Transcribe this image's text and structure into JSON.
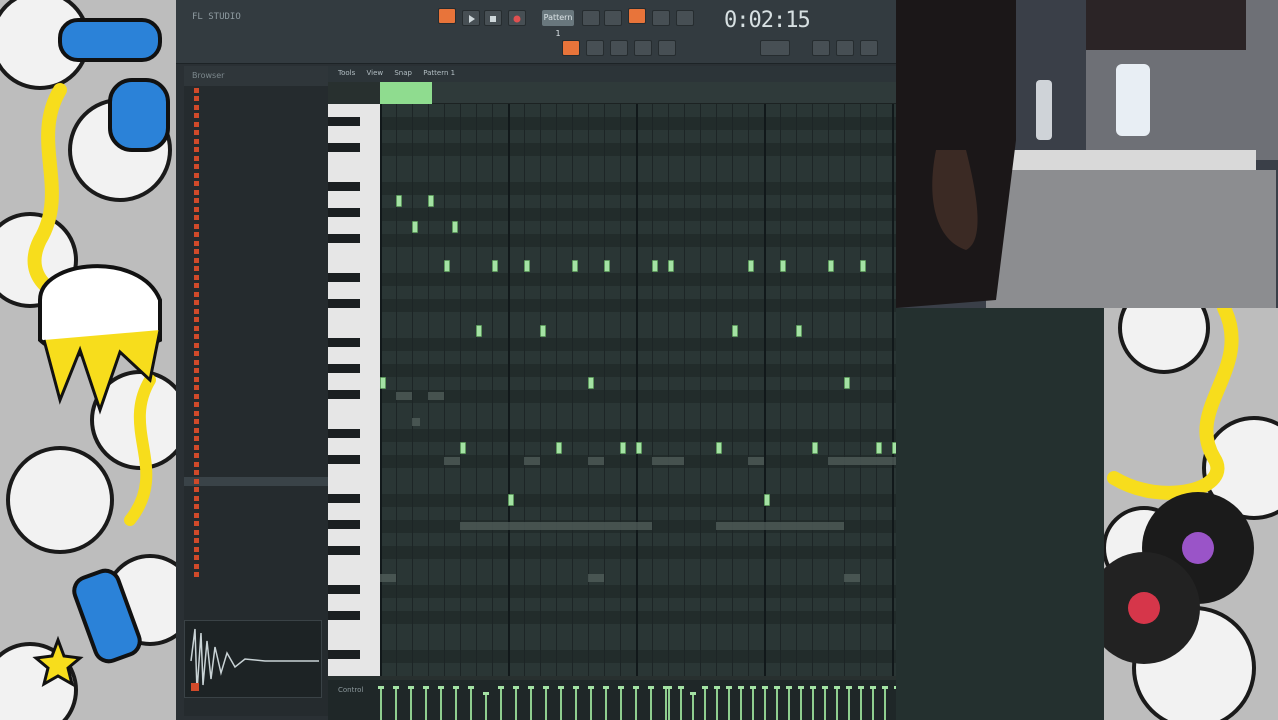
{
  "toolbar": {
    "song_title": "FL STUDIO",
    "time": "0:02:15",
    "pattern": "Pattern 1",
    "hint": ""
  },
  "browser": {
    "header": "Browser"
  },
  "piano_roll": {
    "menu": [
      "Tools",
      "View",
      "Snap",
      "Pattern 1"
    ],
    "notes": [
      {
        "step": 2,
        "row": 7
      },
      {
        "step": 6,
        "row": 7
      },
      {
        "step": 4,
        "row": 9
      },
      {
        "step": 9,
        "row": 9
      },
      {
        "step": 8,
        "row": 12
      },
      {
        "step": 14,
        "row": 12
      },
      {
        "step": 18,
        "row": 12
      },
      {
        "step": 24,
        "row": 12
      },
      {
        "step": 28,
        "row": 12
      },
      {
        "step": 34,
        "row": 12
      },
      {
        "step": 36,
        "row": 12
      },
      {
        "step": 46,
        "row": 12
      },
      {
        "step": 50,
        "row": 12
      },
      {
        "step": 56,
        "row": 12
      },
      {
        "step": 60,
        "row": 12
      },
      {
        "step": 12,
        "row": 17
      },
      {
        "step": 20,
        "row": 17
      },
      {
        "step": 44,
        "row": 17
      },
      {
        "step": 52,
        "row": 17
      },
      {
        "step": 0,
        "row": 21
      },
      {
        "step": 26,
        "row": 21
      },
      {
        "step": 58,
        "row": 21
      },
      {
        "step": 10,
        "row": 26
      },
      {
        "step": 22,
        "row": 26
      },
      {
        "step": 30,
        "row": 26
      },
      {
        "step": 32,
        "row": 26
      },
      {
        "step": 42,
        "row": 26
      },
      {
        "step": 54,
        "row": 26
      },
      {
        "step": 62,
        "row": 26
      },
      {
        "step": 64,
        "row": 26
      },
      {
        "step": 16,
        "row": 30
      },
      {
        "step": 48,
        "row": 30
      }
    ],
    "ghost_notes": [
      {
        "step": 2,
        "row": 22,
        "len": 2
      },
      {
        "step": 6,
        "row": 22,
        "len": 2
      },
      {
        "step": 73,
        "row": 22,
        "len": 4
      },
      {
        "step": 4,
        "row": 24,
        "len": 1
      },
      {
        "step": 69,
        "row": 24,
        "len": 2
      },
      {
        "step": 8,
        "row": 27,
        "len": 2
      },
      {
        "step": 18,
        "row": 27,
        "len": 2
      },
      {
        "step": 26,
        "row": 27,
        "len": 2
      },
      {
        "step": 34,
        "row": 27,
        "len": 4
      },
      {
        "step": 46,
        "row": 27,
        "len": 2
      },
      {
        "step": 56,
        "row": 27,
        "len": 18
      },
      {
        "step": 10,
        "row": 32,
        "len": 24
      },
      {
        "step": 42,
        "row": 32,
        "len": 16
      },
      {
        "step": 0,
        "row": 36,
        "len": 2
      },
      {
        "step": 26,
        "row": 36,
        "len": 2
      },
      {
        "step": 58,
        "row": 36,
        "len": 2
      }
    ],
    "velocity_label": "Control",
    "velocities": [
      1,
      1,
      1,
      1,
      1,
      1,
      1,
      0.8,
      1,
      1,
      1,
      1,
      1,
      1,
      1,
      1,
      1,
      1,
      1,
      1,
      1,
      1,
      1,
      0.8,
      1,
      1,
      1,
      1,
      1,
      1,
      1,
      1,
      1,
      1,
      1,
      1,
      1,
      1,
      1,
      1,
      1
    ]
  },
  "colors": {
    "note": "#a4e2a4",
    "accent": "#e8743a"
  },
  "icons": [
    "play-icon",
    "stop-icon",
    "record-icon",
    "metronome-icon",
    "snap-icon",
    "draw-icon",
    "paint-icon",
    "delete-icon",
    "mute-icon",
    "slice-icon",
    "select-icon",
    "zoom-icon"
  ]
}
